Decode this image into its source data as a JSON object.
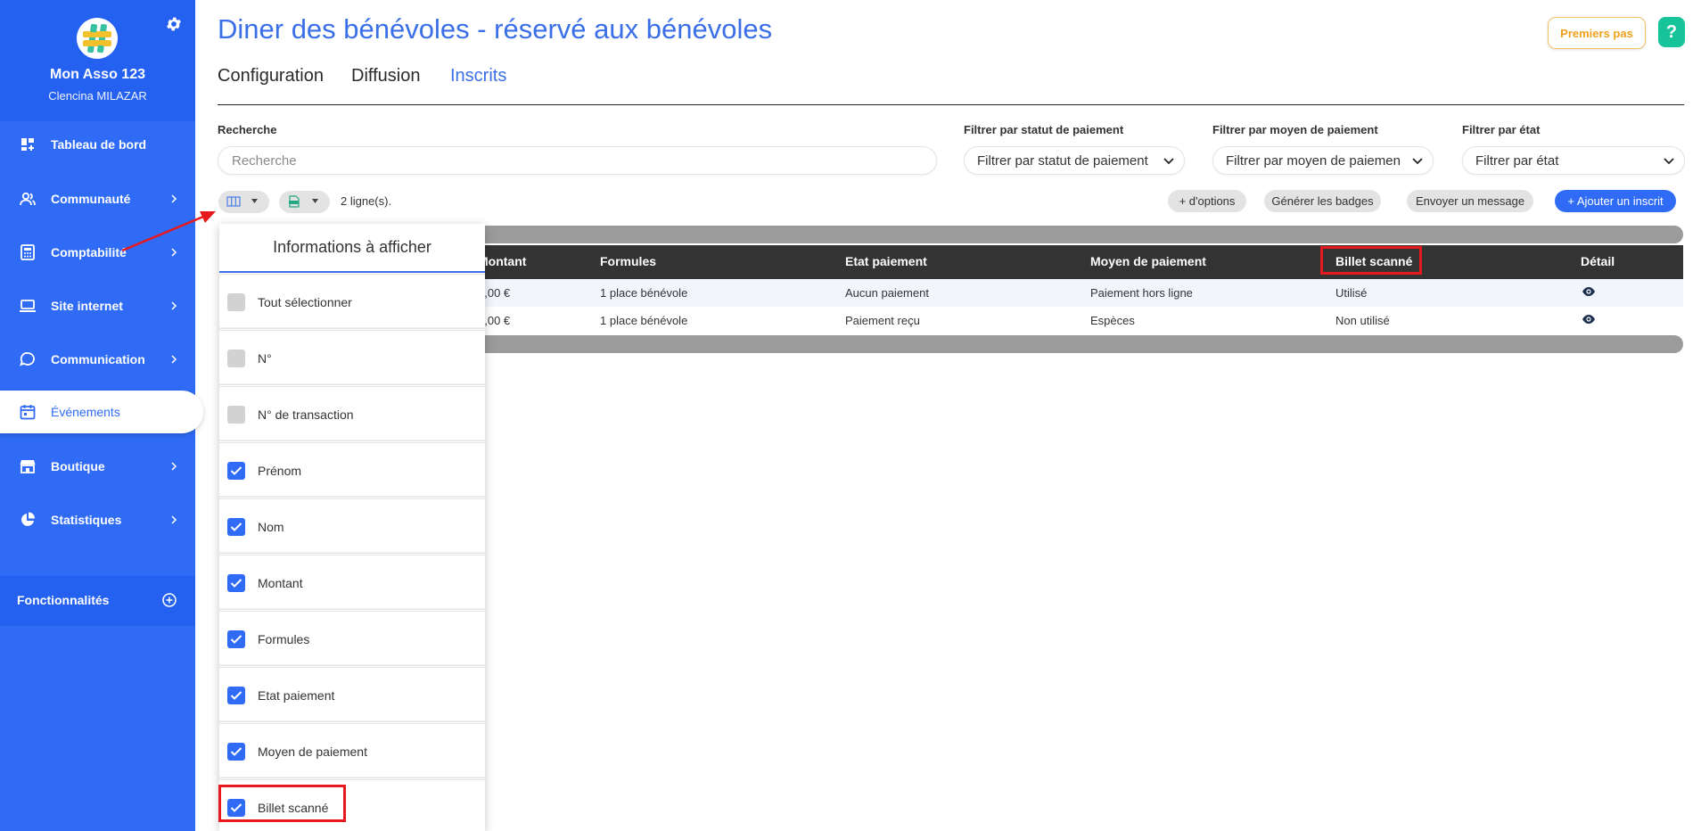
{
  "sidebar": {
    "org_name": "Mon Asso 123",
    "org_user": "Clencina MILAZAR",
    "items": [
      {
        "label": "Tableau de bord",
        "icon": "dashboard-icon"
      },
      {
        "label": "Communauté",
        "icon": "community-icon"
      },
      {
        "label": "Comptabilité",
        "icon": "calculator-icon"
      },
      {
        "label": "Site internet",
        "icon": "laptop-icon"
      },
      {
        "label": "Communication",
        "icon": "chat-icon"
      },
      {
        "label": "Événements",
        "icon": "calendar-icon"
      },
      {
        "label": "Boutique",
        "icon": "shop-icon"
      },
      {
        "label": "Statistiques",
        "icon": "pie-chart-icon"
      }
    ],
    "active_item": "Événements",
    "features_label": "Fonctionnalités"
  },
  "header": {
    "title": "Diner des bénévoles - réservé aux bénévoles",
    "premiers_pas": "Premiers pas",
    "help": "?"
  },
  "tabs": [
    {
      "label": "Configuration"
    },
    {
      "label": "Diffusion"
    },
    {
      "label": "Inscrits"
    }
  ],
  "active_tab": "Inscrits",
  "filters": {
    "search_label": "Recherche",
    "search_placeholder": "Recherche",
    "payment_status_label": "Filtrer par statut de paiement",
    "payment_status_value": "Filtrer par statut de paiement",
    "payment_method_label": "Filtrer par moyen de paiement",
    "payment_method_value": "Filtrer par moyen de paiement",
    "state_label": "Filtrer par état",
    "state_value": "Filtrer par état"
  },
  "toolbar": {
    "row_count": "2 ligne(s).",
    "more_options": "+ d'options",
    "generate_badges": "Générer les badges",
    "send_message": "Envoyer un message",
    "add_registrant": "+ Ajouter un inscrit"
  },
  "table": {
    "headers": [
      "Montant",
      "Formules",
      "Etat paiement",
      "Moyen de paiement",
      "Billet scanné",
      "Détail"
    ],
    "rows": [
      [
        "0,00 €",
        "1 place bénévole",
        "Aucun paiement",
        "Paiement hors ligne",
        "Utilisé"
      ],
      [
        "0,00 €",
        "1 place bénévole",
        "Paiement reçu",
        "Espèces",
        "Non utilisé"
      ]
    ]
  },
  "column_panel": {
    "title": "Informations à afficher",
    "options": [
      {
        "label": "Tout sélectionner",
        "checked": false
      },
      {
        "label": "N°",
        "checked": false
      },
      {
        "label": "N° de transaction",
        "checked": false
      },
      {
        "label": "Prénom",
        "checked": true
      },
      {
        "label": "Nom",
        "checked": true
      },
      {
        "label": "Montant",
        "checked": true
      },
      {
        "label": "Formules",
        "checked": true
      },
      {
        "label": "Etat paiement",
        "checked": true
      },
      {
        "label": "Moyen de paiement",
        "checked": true
      },
      {
        "label": "Billet scanné",
        "checked": true
      }
    ]
  },
  "colors": {
    "brand_blue": "#2f6bf5",
    "title_blue": "#3a6fe8",
    "highlight_red": "#e8191d",
    "premiers_pas_orange": "#efa11e",
    "help_green": "#17c49a",
    "table_header": "#333333"
  }
}
